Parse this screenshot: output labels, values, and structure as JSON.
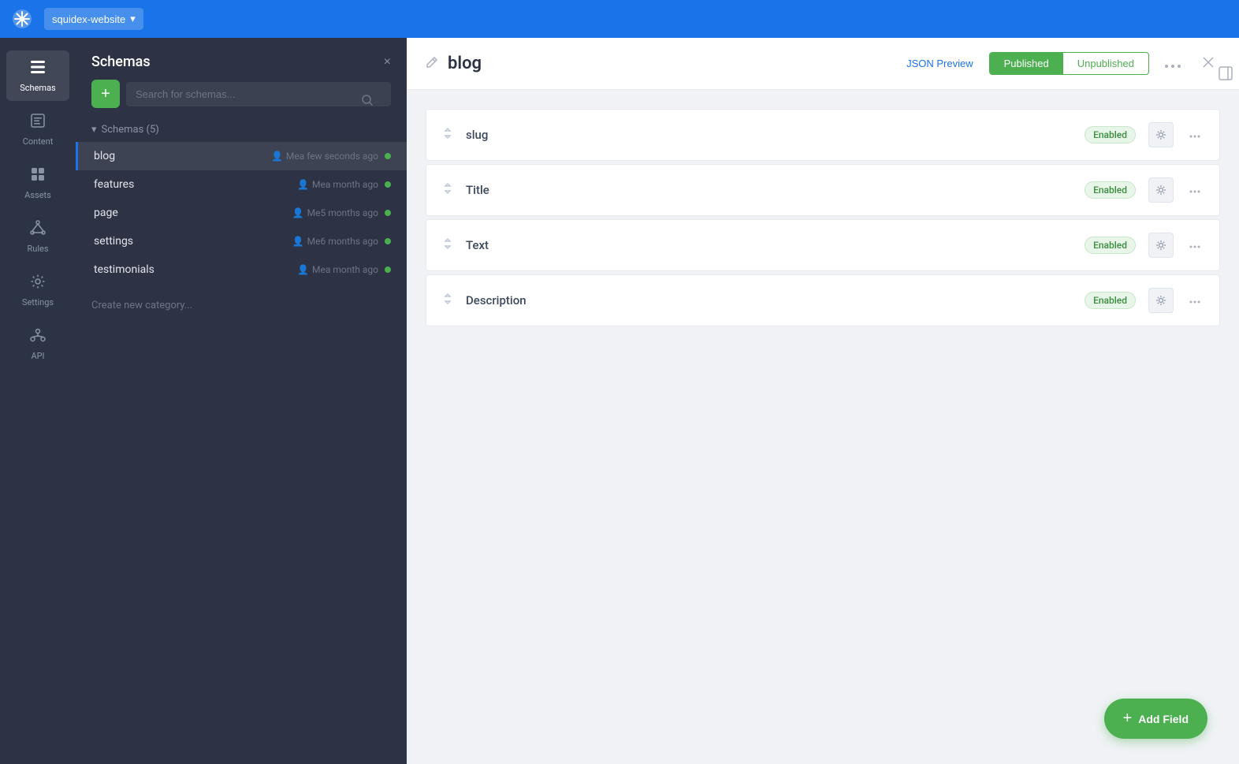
{
  "topbar": {
    "logo_symbol": "❄",
    "app_name": "squidex-website",
    "dropdown_icon": "▾"
  },
  "nav": {
    "items": [
      {
        "id": "schemas",
        "label": "Schemas",
        "icon": "☰",
        "active": true
      },
      {
        "id": "content",
        "label": "Content",
        "icon": "📄",
        "active": false
      },
      {
        "id": "assets",
        "label": "Assets",
        "icon": "🖼",
        "active": false
      },
      {
        "id": "rules",
        "label": "Rules",
        "icon": "⚙",
        "active": false
      },
      {
        "id": "settings",
        "label": "Settings",
        "icon": "⚙",
        "active": false
      },
      {
        "id": "api",
        "label": "API",
        "icon": "⬡",
        "active": false
      }
    ]
  },
  "schemas_panel": {
    "title": "Schemas",
    "close_icon": "×",
    "add_btn_label": "+",
    "search_placeholder": "Search for schemas...",
    "search_icon": "🔍",
    "category": {
      "label": "Schemas (5)",
      "collapse_icon": "▾"
    },
    "items": [
      {
        "name": "blog",
        "user": "Me",
        "time": "a few seconds ago",
        "active": true
      },
      {
        "name": "features",
        "user": "Me",
        "time": "a month ago",
        "active": false
      },
      {
        "name": "page",
        "user": "Me",
        "time": "5 months ago",
        "active": false
      },
      {
        "name": "settings",
        "user": "Me",
        "time": "6 months ago",
        "active": false
      },
      {
        "name": "testimonials",
        "user": "Me",
        "time": "a month ago",
        "active": false
      }
    ],
    "create_category_label": "Create new category..."
  },
  "main": {
    "edit_icon": "✏",
    "title": "blog",
    "json_preview_label": "JSON Preview",
    "toggle": {
      "published_label": "Published",
      "unpublished_label": "Unpublished",
      "active": "published"
    },
    "more_icon": "···",
    "close_icon": "×",
    "sidebar_toggle_icon": "≡",
    "fields": [
      {
        "name": "slug",
        "status": "Enabled",
        "drag_icon": "△"
      },
      {
        "name": "Title",
        "status": "Enabled",
        "drag_icon": "△"
      },
      {
        "name": "Text",
        "status": "Enabled",
        "drag_icon": "△"
      },
      {
        "name": "Description",
        "status": "Enabled",
        "drag_icon": "△"
      }
    ],
    "add_field_label": "Add Field",
    "add_field_icon": "+"
  }
}
